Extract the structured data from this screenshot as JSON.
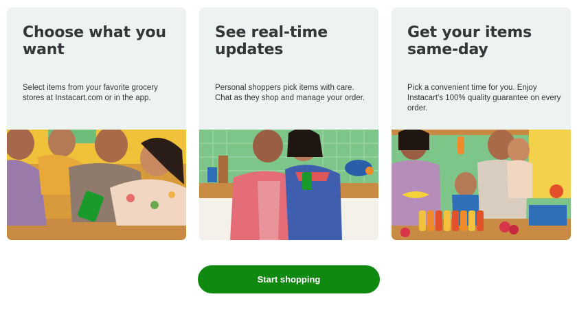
{
  "cards": [
    {
      "title": "Choose what you want",
      "description": "Select items from your favorite grocery stores at Instacart.com or in the app.",
      "image_icon": "family-with-phone-photo"
    },
    {
      "title": "See real-time updates",
      "description": "Personal shoppers pick items with care. Chat as they shop and manage your order.",
      "image_icon": "couple-in-kitchen-photo"
    },
    {
      "title": "Get your items same-day",
      "description": "Pick a convenient time for you. Enjoy Instacart's 100% quality guarantee on every order.",
      "image_icon": "family-with-groceries-photo"
    }
  ],
  "cta": {
    "label": "Start shopping"
  },
  "colors": {
    "card_background": "#edf3f0",
    "text": "#343538",
    "cta_background": "#108910",
    "cta_text": "#ffffff"
  }
}
